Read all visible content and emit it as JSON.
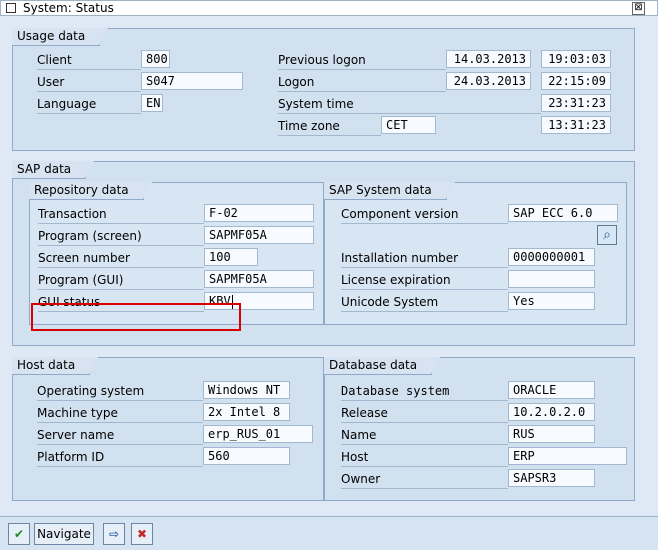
{
  "window": {
    "title": "System: Status",
    "close_glyph": "⊠"
  },
  "usage": {
    "group_title": "Usage data",
    "client_label": "Client",
    "client_value": "800",
    "user_label": "User",
    "user_value": "S047",
    "language_label": "Language",
    "language_value": "EN",
    "previous_logon_label": "Previous logon",
    "previous_logon_date": "14.03.2013",
    "previous_logon_time": "19:03:03",
    "logon_label": "Logon",
    "logon_date": "24.03.2013",
    "logon_time": "22:15:09",
    "system_time_label": "System time",
    "system_time": "23:31:23",
    "time_zone_label": "Time zone",
    "time_zone_value": "CET",
    "time_zone_time": "13:31:23"
  },
  "sap_data": {
    "group_title": "SAP data",
    "repository": {
      "title": "Repository data",
      "transaction_label": "Transaction",
      "transaction_value": "F-02",
      "program_screen_label": "Program (screen)",
      "program_screen_value": "SAPMF05A",
      "screen_number_label": "Screen number",
      "screen_number_value": "100",
      "program_gui_label": "Program (GUI)",
      "program_gui_value": "SAPMF05A",
      "gui_status_label": "GUI status",
      "gui_status_value": "KBV"
    },
    "system": {
      "title": "SAP System data",
      "component_version_label": "Component version",
      "component_version_value": "SAP ECC 6.0",
      "installation_number_label": "Installation number",
      "installation_number_value": "0000000001",
      "license_expiration_label": "License expiration",
      "license_expiration_value": "",
      "unicode_system_label": "Unicode System",
      "unicode_system_value": "Yes"
    }
  },
  "host": {
    "group_title": "Host data",
    "os_label": "Operating system",
    "os_value": "Windows NT",
    "machine_type_label": "Machine type",
    "machine_type_value": "2x Intel 8",
    "server_name_label": "Server name",
    "server_name_value": "erp_RUS_01",
    "platform_id_label": "Platform ID",
    "platform_id_value": "560"
  },
  "database": {
    "group_title": "Database data",
    "database_system_label": "Database system",
    "database_system_value": "ORACLE",
    "release_label": "Release",
    "release_value": "10.2.0.2.0",
    "name_label": "Name",
    "name_value": "RUS",
    "host_label": "Host",
    "host_value": "ERP",
    "owner_label": "Owner",
    "owner_value": "SAPSR3"
  },
  "footer": {
    "ok_icon_glyph": "✔",
    "navigate_label": "Navigate",
    "export_icon_glyph": "⇨",
    "cancel_icon_glyph": "✖"
  },
  "icons": {
    "component_details_icon": "magnifier-icon",
    "highlight_color": "#d80000"
  }
}
